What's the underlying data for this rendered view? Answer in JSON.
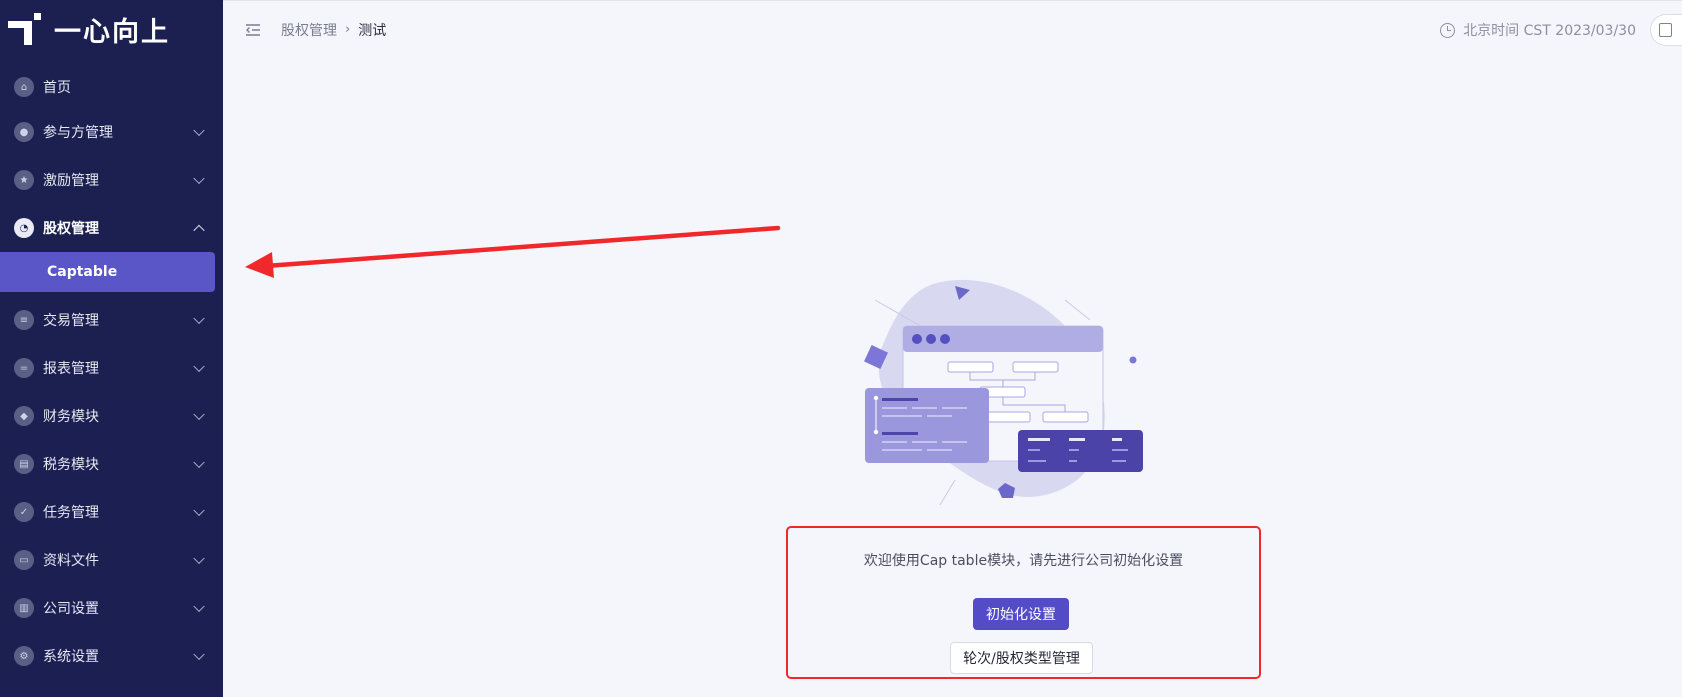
{
  "app": {
    "logo_text": "一心向上"
  },
  "sidebar": {
    "items": [
      {
        "label": "首页",
        "icon": "home-icon"
      },
      {
        "label": "参与方管理",
        "icon": "participants-icon"
      },
      {
        "label": "激励管理",
        "icon": "incentive-icon"
      },
      {
        "label": "股权管理",
        "icon": "equity-pie-icon",
        "expanded": true,
        "children": [
          {
            "label": "Captable",
            "active": true
          }
        ]
      },
      {
        "label": "交易管理",
        "icon": "transaction-icon"
      },
      {
        "label": "报表管理",
        "icon": "report-icon"
      },
      {
        "label": "财务模块",
        "icon": "finance-icon"
      },
      {
        "label": "税务模块",
        "icon": "tax-icon"
      },
      {
        "label": "任务管理",
        "icon": "task-icon"
      },
      {
        "label": "资料文件",
        "icon": "folder-icon"
      },
      {
        "label": "公司设置",
        "icon": "company-icon"
      },
      {
        "label": "系统设置",
        "icon": "system-settings-icon"
      }
    ]
  },
  "header": {
    "breadcrumb_parent": "股权管理",
    "breadcrumb_current": "测试",
    "time_text": "北京时间 CST 2023/03/30"
  },
  "main": {
    "welcome_text": "欢迎使用Cap table模块，请先进行公司初始化设置",
    "init_button": "初始化设置",
    "manage_button": "轮次/股权类型管理"
  },
  "colors": {
    "sidebar_bg": "#1b1f52",
    "accent": "#544cc6",
    "annotation_red": "#f0282b"
  }
}
